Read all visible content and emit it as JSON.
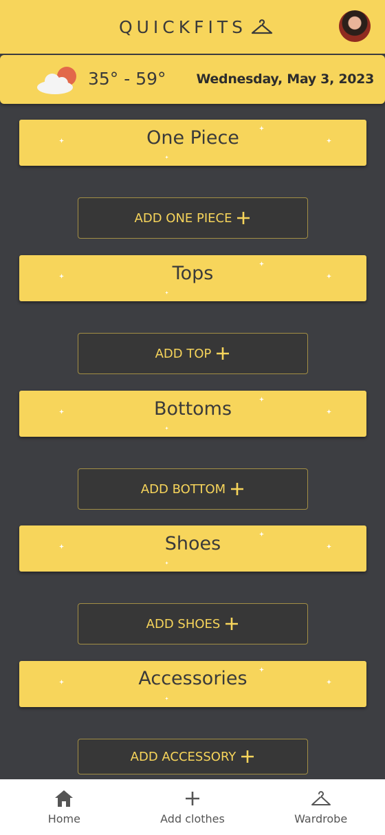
{
  "app": {
    "title": "QUICKFITS",
    "logo_icon": "hanger-icon",
    "avatar_icon": "user-avatar"
  },
  "weather": {
    "icon": "partly-cloudy-icon",
    "temperature": "35° - 59°",
    "date": "Wednesday, May 3, 2023"
  },
  "categories": [
    {
      "label": "One Piece",
      "add_label": "ADD ONE PIECE"
    },
    {
      "label": "Tops",
      "add_label": "ADD TOP"
    },
    {
      "label": "Bottoms",
      "add_label": "ADD BOTTOM"
    },
    {
      "label": "Shoes",
      "add_label": "ADD SHOES"
    },
    {
      "label": "Accessories",
      "add_label": "ADD ACCESSORY"
    }
  ],
  "nav": {
    "items": [
      {
        "label": "Home",
        "icon": "home-icon"
      },
      {
        "label": "Add clothes",
        "icon": "plus-icon"
      },
      {
        "label": "Wardrobe",
        "icon": "hanger-icon"
      }
    ]
  },
  "colors": {
    "accent": "#f7d55b",
    "background": "#3d3e42",
    "button_bg": "#373737",
    "button_border": "#a38f45"
  }
}
